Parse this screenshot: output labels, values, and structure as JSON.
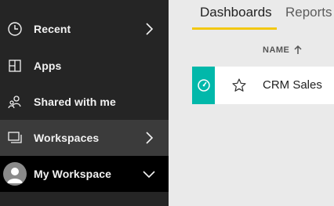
{
  "sidebar": {
    "items": [
      {
        "label": "Recent",
        "icon": "clock-icon",
        "has_chevron": true
      },
      {
        "label": "Apps",
        "icon": "apps-icon",
        "has_chevron": false
      },
      {
        "label": "Shared with me",
        "icon": "shared-people-icon",
        "has_chevron": false
      },
      {
        "label": "Workspaces",
        "icon": "workspaces-icon",
        "has_chevron": true,
        "state": "hover"
      },
      {
        "label": "My Workspace",
        "icon": "avatar",
        "has_chevron": true,
        "state": "selected",
        "chevron": "down"
      }
    ]
  },
  "main": {
    "tabs": [
      {
        "label": "Dashboards",
        "active": true
      },
      {
        "label": "Reports",
        "active": false
      }
    ],
    "column_header": "NAME",
    "sort": "ascending",
    "rows": [
      {
        "name": "CRM Sales",
        "icon": "dashboard-gauge-icon",
        "favorite": false
      }
    ]
  },
  "colors": {
    "sidebar_bg": "#252525",
    "hover_bg": "#3b3b3b",
    "selected_bg": "#000000",
    "accent_tab": "#f2c811",
    "tile_teal": "#01b8aa"
  }
}
